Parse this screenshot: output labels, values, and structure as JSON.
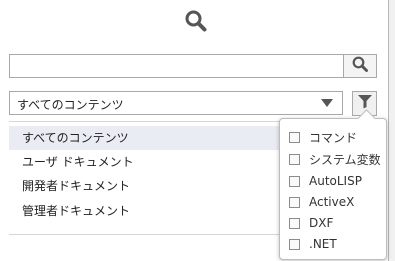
{
  "search": {
    "value": "",
    "placeholder": ""
  },
  "content_select": {
    "selected": "すべてのコンテンツ"
  },
  "list": {
    "items": [
      {
        "label": "すべてのコンテンツ"
      },
      {
        "label": "ユーザ ドキュメント"
      },
      {
        "label": "開発者ドキュメント"
      },
      {
        "label": "管理者ドキュメント"
      }
    ]
  },
  "filter_popup": {
    "options": [
      {
        "label": "コマンド"
      },
      {
        "label": "システム変数"
      },
      {
        "label": "AutoLISP"
      },
      {
        "label": "ActiveX"
      },
      {
        "label": "DXF"
      },
      {
        "label": ".NET"
      }
    ]
  },
  "icons": {
    "top": "search-icon",
    "search_button": "search-icon",
    "dropdown": "chevron-down-icon",
    "filter": "filter-icon"
  },
  "colors": {
    "icon_gray": "#555555",
    "selected_row": "#e9ecf2",
    "border": "#a9a9a9"
  }
}
